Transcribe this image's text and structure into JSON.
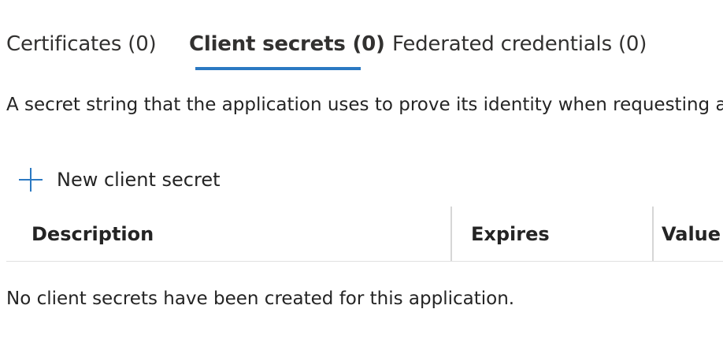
{
  "tabs": [
    {
      "label": "Certificates (0)",
      "active": false
    },
    {
      "label": "Client secrets (0)",
      "active": true
    },
    {
      "label": "Federated credentials (0)",
      "active": false
    }
  ],
  "description": "A secret string that the application uses to prove its identity when requesting a token.",
  "toolbar": {
    "new_secret_label": "New client secret",
    "new_secret_icon": "plus-icon"
  },
  "table": {
    "columns": [
      "Description",
      "Expires",
      "Value"
    ],
    "empty_message": "No client secrets have been created for this application."
  },
  "colors": {
    "accent": "#2b79c2",
    "text": "#242424",
    "divider": "#d6d6d6"
  }
}
